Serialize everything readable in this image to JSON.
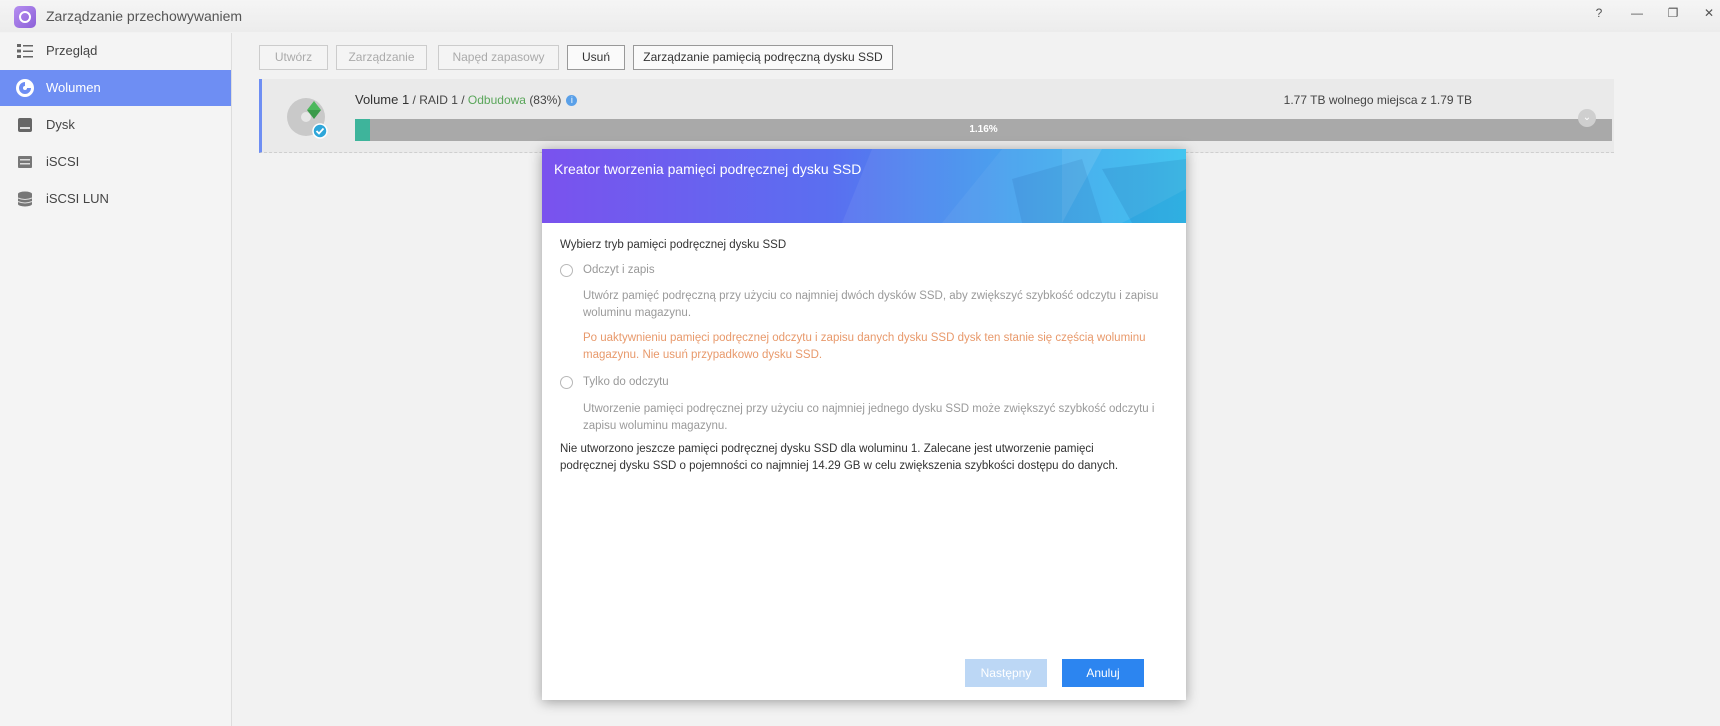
{
  "window": {
    "title": "Zarządzanie przechowywaniem",
    "help_glyph": "?",
    "minimize_glyph": "—",
    "maximize_glyph": "❐",
    "close_glyph": "✕"
  },
  "sidebar": {
    "items": [
      {
        "label": "Przegląd",
        "icon": "overview-list-icon"
      },
      {
        "label": "Wolumen",
        "icon": "volume-icon",
        "active": true
      },
      {
        "label": "Dysk",
        "icon": "disk-icon"
      },
      {
        "label": "iSCSI",
        "icon": "iscsi-icon"
      },
      {
        "label": "iSCSI LUN",
        "icon": "iscsi-lun-icon"
      }
    ]
  },
  "toolbar": {
    "create": "Utwórz",
    "manage": "Zarządzanie",
    "spare": "Napęd zapasowy",
    "remove": "Usuń",
    "ssd_cache": "Zarządzanie pamięcią podręczną dysku SSD"
  },
  "volume": {
    "name": "Volume 1",
    "raid": "RAID 1",
    "status": "Odbudowa",
    "status_percent": "(83%)",
    "separator": " / ",
    "info_glyph": "i",
    "free_space": "1.77 TB wolnego miejsca z 1.79 TB",
    "usage_label": "1.16%",
    "usage_fraction": 0.0116,
    "expand_glyph": "⌄"
  },
  "dialog": {
    "title": "Kreator tworzenia pamięci podręcznej dysku SSD",
    "prompt": "Wybierz tryb pamięci podręcznej dysku SSD",
    "option_rw": {
      "label": "Odczyt i zapis",
      "desc_1": "Utwórz pamięć podręczną przy użyciu co najmniej dwóch dysków SSD, aby zwiększyć szybkość odczytu i zapisu",
      "desc_2": "woluminu magazynu.",
      "warn_1": "Po uaktywnieniu pamięci podręcznej odczytu i zapisu danych dysku SSD dysk ten stanie się częścią woluminu",
      "warn_2": "magazynu. Nie usuń przypadkowo dysku SSD."
    },
    "option_ro": {
      "label": "Tylko do odczytu",
      "desc_1": "Utworzenie pamięci podręcznej przy użyciu co najmniej jednego dysku SSD może zwiększyć szybkość odczytu i",
      "desc_2": "zapisu woluminu magazynu."
    },
    "note_1": "Nie utworzono jeszcze pamięci podręcznej dysku SSD dla woluminu 1. Zalecane jest utworzenie pamięci",
    "note_2": "podręcznej dysku SSD o pojemności co najmniej 14.29 GB w celu zwiększenia szybkości dostępu do danych.",
    "next_button": "Następny",
    "cancel_button": "Anuluj"
  },
  "colors": {
    "accent": "#6e8ef3",
    "progress_fill": "#3eb49b",
    "rebuild_status": "#5aa65a",
    "warning_text": "#e8996b",
    "primary_button": "#2c85f0"
  }
}
